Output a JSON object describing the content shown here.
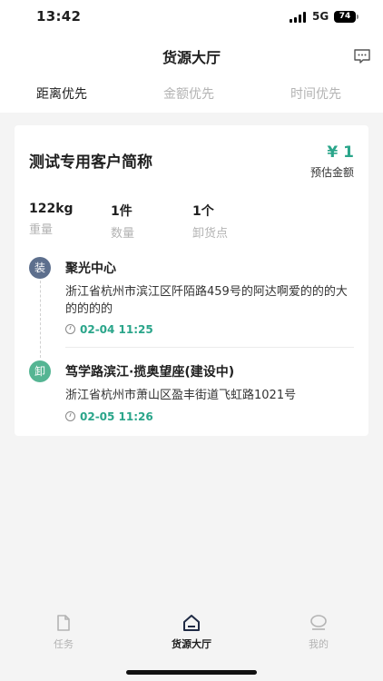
{
  "status_bar": {
    "time": "13:42",
    "network": "5G",
    "battery": "74"
  },
  "nav": {
    "title": "货源大厅"
  },
  "tabs": [
    {
      "label": "距离优先",
      "active": true
    },
    {
      "label": "金额优先",
      "active": false
    },
    {
      "label": "时间优先",
      "active": false
    }
  ],
  "order": {
    "customer": "测试专用客户简称",
    "price": "¥ 1",
    "price_label": "预估金额",
    "stats": [
      {
        "value": "122kg",
        "label": "重量"
      },
      {
        "value": "1件",
        "label": "数量"
      },
      {
        "value": "1个",
        "label": "卸货点"
      }
    ],
    "load": {
      "badge": "装",
      "name": "聚光中心",
      "address": "浙江省杭州市滨江区阡陌路459号的阿达啊爱的的的大的的的的",
      "time": "02-04 11:25"
    },
    "unload": {
      "badge": "卸",
      "name": "笃学路滨江·揽奥望座(建设中)",
      "address": "浙江省杭州市萧山区盈丰街道飞虹路1021号",
      "time": "02-05 11:26"
    }
  },
  "tabbar": [
    {
      "label": "任务",
      "icon": "document-icon",
      "active": false
    },
    {
      "label": "货源大厅",
      "icon": "home-icon",
      "active": true
    },
    {
      "label": "我的",
      "icon": "profile-icon",
      "active": false
    }
  ],
  "colors": {
    "accent": "#2aa58a",
    "load_badge": "#5d6f8d",
    "unload_badge": "#55b593"
  }
}
